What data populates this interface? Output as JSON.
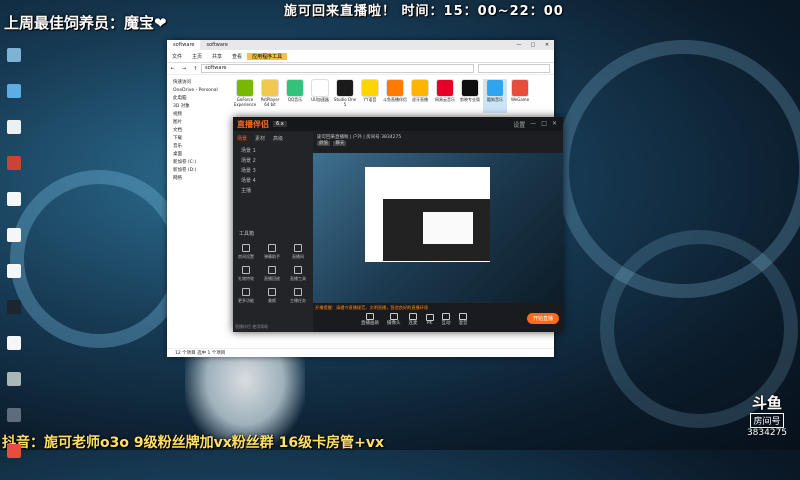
{
  "overlay": {
    "top_left": "上周最佳饲养员：魔宝❤",
    "top_center": "旎可回来直播啦！ 时间：15：00~22：00",
    "bottom_left": "抖音：旎可老师o3o  9级粉丝牌加vx粉丝群  16级卡房管+vx",
    "douyu_logo": "斗鱼",
    "douyu_sub": "房间号",
    "room_number": "3834275"
  },
  "explorer": {
    "tabs": [
      "software",
      "software"
    ],
    "window_controls": [
      "—",
      "□",
      "✕"
    ],
    "ribbon": [
      "文件",
      "主页",
      "共享",
      "查看",
      "应用程序工具"
    ],
    "active_ribbon": "应用程序工具",
    "path": "software",
    "nav_pane": [
      "快速访问",
      "OneDrive - Personal",
      "此电脑",
      "3D 对象",
      "视频",
      "图片",
      "文档",
      "下载",
      "音乐",
      "桌面",
      "新加卷 (C:)",
      "新加卷 (D:)",
      "网络"
    ],
    "files": [
      {
        "label": "GeForce Experience",
        "color": "#76b900"
      },
      {
        "label": "PotPlayer 64 bit",
        "color": "#f2c94c"
      },
      {
        "label": "QQ音乐",
        "color": "#31c27c"
      },
      {
        "label": "UU加速器",
        "color": "#ffffff"
      },
      {
        "label": "Studio One 5",
        "color": "#1a1a1a"
      },
      {
        "label": "YY语音",
        "color": "#ffd400"
      },
      {
        "label": "斗鱼直播伴侣",
        "color": "#ff7a00"
      },
      {
        "label": "虎牙直播",
        "color": "#ffb400"
      },
      {
        "label": "网易云音乐",
        "color": "#e60026"
      },
      {
        "label": "剪映专业版",
        "color": "#0f0f0f"
      },
      {
        "label": "酷狗音乐",
        "color": "#2ca6f3"
      },
      {
        "label": "WeGame",
        "color": "#e84c3d"
      }
    ],
    "status": "12 个项目   选中 1 个项目"
  },
  "streaming_app": {
    "app_name": "直播伴侣",
    "version": "6.x",
    "title_controls": [
      "设置",
      "—",
      "□",
      "✕"
    ],
    "left_tabs": [
      "场景",
      "素材",
      "高级"
    ],
    "scenes": [
      "场景 1",
      "场景 2",
      "场景 3",
      "场景 4",
      "主播"
    ],
    "tools_title": "工具箱",
    "tools": [
      "房间设置",
      "弹幕助手",
      "直播间",
      "礼物特效",
      "直播回放",
      "直播工具",
      "更多功能",
      "美颜",
      "主播任务"
    ],
    "room_info": "旎可回来直播啦 | 户外 | 房间号 3834275",
    "tags": [
      "颜值",
      "聊天"
    ],
    "warning": "开播提醒：请遵守直播规范，文明直播，营造良好的直播环境",
    "bottom_buttons": [
      "直播画质",
      "摄像头",
      "连麦",
      "PK",
      "互动",
      "混音"
    ],
    "go_live": "开始直播",
    "footer": "直播伴侣 使用帮助"
  }
}
